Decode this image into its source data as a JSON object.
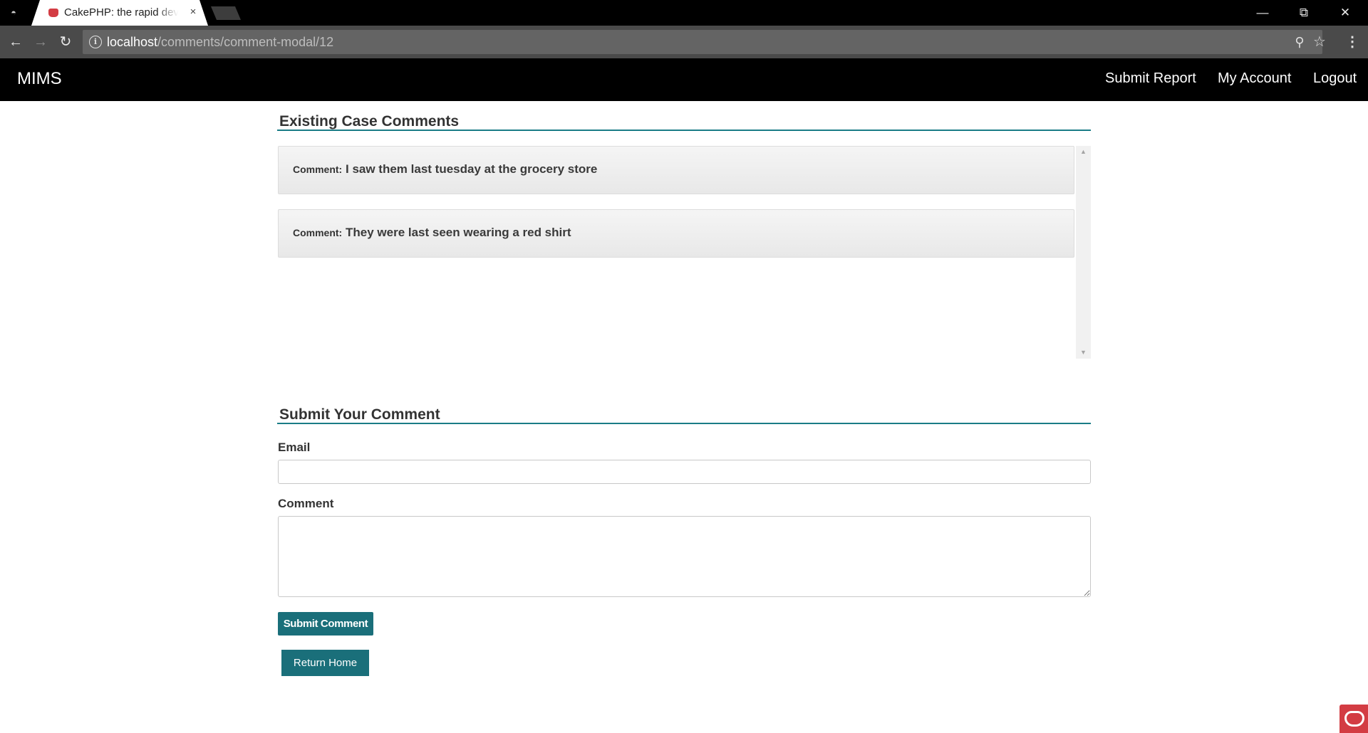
{
  "browser": {
    "tab_title": "CakePHP: the rapid development php framework",
    "tab_close": "×",
    "url_host": "localhost",
    "url_path": "/comments/comment-modal/12",
    "incognito_glyph": "◓",
    "icons": [
      "incognito-icon",
      "favicon-icon",
      "close-icon",
      "back-icon",
      "forward-icon",
      "reload-icon",
      "info-icon",
      "zoom-icon",
      "star-icon",
      "menu-icon",
      "minimize-icon",
      "restore-icon",
      "window-close-icon"
    ]
  },
  "app": {
    "brand": "MIMS",
    "nav": {
      "submit_report": "Submit Report",
      "my_account": "My Account",
      "logout": "Logout"
    }
  },
  "existing": {
    "title": "Existing Case Comments",
    "comments": [
      {
        "label": "Comment:",
        "text": "I saw them last tuesday at the grocery store"
      },
      {
        "label": "Comment:",
        "text": "They were last seen wearing a red shirt"
      }
    ]
  },
  "form": {
    "title": "Submit Your Comment",
    "email_label": "Email",
    "email_value": "",
    "comment_label": "Comment",
    "comment_value": "",
    "submit_label": "Submit Comment",
    "home_label": "Return Home"
  },
  "colors": {
    "accent": "#1a6f7a",
    "rule": "#1a7c86",
    "navbar": "#000000",
    "cake_red": "#d33c43"
  }
}
